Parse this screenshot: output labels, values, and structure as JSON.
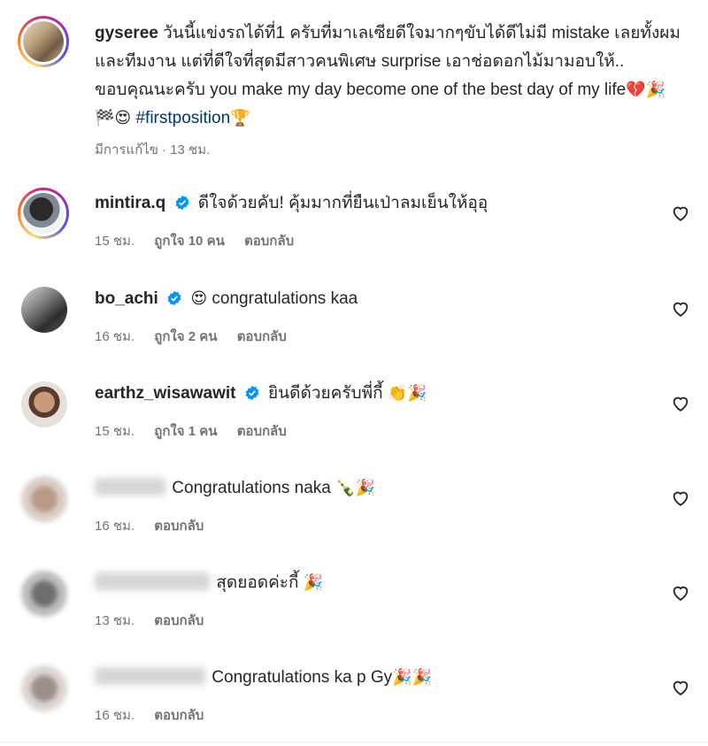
{
  "caption": {
    "username": "gyseree",
    "text": "วันนี้แข่งรถได้ที่1 ครับที่มาเลเซียดีใจมากๆขับได้ดีไม่มี mistake เลยทั้งผมและทีมงาน แต่ที่ดีใจที่สุดมีสาวคนพิเศษ surprise เอาช่อดอกไม้มามอบให้.. ขอบคุณนะครับ you make my day become one of the best day of my life",
    "emojis": "💔🎉🏁😍",
    "hashtag": "#firstposition",
    "trophy": "🏆",
    "edited": "มีการแก้ไข",
    "time": "13 ชม."
  },
  "comments": [
    {
      "username": "mintira.q",
      "verified": true,
      "text": "ดีใจด้วยคับ! คุ้มมากที่ยืนเป่าลมเย็นให้อุอุ",
      "time": "15 ชม.",
      "likes": "ถูกใจ 10 คน",
      "reply": "ตอบกลับ"
    },
    {
      "username": "bo_achi",
      "verified": true,
      "emoji": "😍",
      "text": "congratulations kaa",
      "time": "16 ชม.",
      "likes": "ถูกใจ 2 คน",
      "reply": "ตอบกลับ"
    },
    {
      "username": "earthz_wisawawit",
      "verified": true,
      "text": "ยินดีด้วยครับพี่กี้",
      "emoji": "👏🎉",
      "time": "15 ชม.",
      "likes": "ถูกใจ 1 คน",
      "reply": "ตอบกลับ"
    },
    {
      "text": "Congratulations naka",
      "emoji": "🍾🎉",
      "time": "16 ชม.",
      "reply": "ตอบกลับ"
    },
    {
      "text": "สุดยอดค่ะกี้",
      "emoji": "🎉",
      "time": "13 ชม.",
      "reply": "ตอบกลับ"
    },
    {
      "text": "Congratulations ka p Gy",
      "emoji": "🎉🎉",
      "time": "16 ชม.",
      "reply": "ตอบกลับ"
    }
  ],
  "icons": {
    "heart": "heart-outline-icon",
    "verified": "verified-badge-icon"
  },
  "colors": {
    "text": "#262626",
    "secondary": "#737373",
    "link": "#00376b",
    "verified": "#0095f6"
  }
}
